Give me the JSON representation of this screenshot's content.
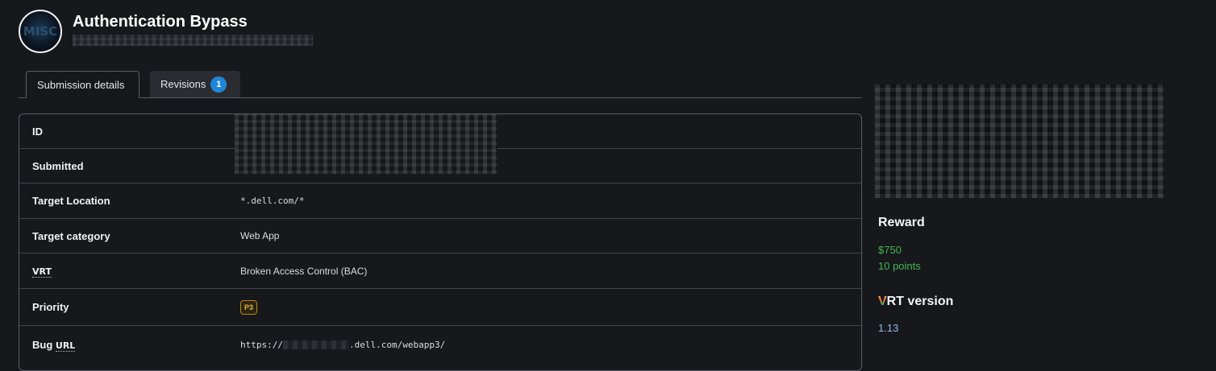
{
  "header": {
    "logo_text": "MISC",
    "title": "Authentication Bypass"
  },
  "tabs": [
    {
      "label": "Submission details",
      "active": true
    },
    {
      "label": "Revisions",
      "badge": "1",
      "active": false
    }
  ],
  "details": {
    "id_label": "ID",
    "submitted_label": "Submitted",
    "target_location_label": "Target Location",
    "target_location_value": "*.dell.com/*",
    "target_category_label": "Target category",
    "target_category_value": "Web App",
    "vrt_label": "VRT",
    "vrt_value": "Broken Access Control (BAC)",
    "priority_label": "Priority",
    "priority_value": "P3",
    "bug_url_label_prefix": "Bug",
    "bug_url_label_abbr": "URL",
    "bug_url_prefix": "https://",
    "bug_url_suffix": ".dell.com/webapp3/"
  },
  "sidebar": {
    "reward_heading": "Reward",
    "reward_amount": "$750",
    "reward_points": "10 points",
    "vrt_heading_logo_v": "V",
    "vrt_heading_logo_rt": "RT",
    "vrt_heading_text": "version",
    "vrt_version": "1.13"
  },
  "colors": {
    "background": "#17181c",
    "accent_badge": "#1f86d6",
    "reward_green": "#3fb950",
    "priority_amber": "#e3b53a",
    "link_blue": "#8fb8ef"
  }
}
